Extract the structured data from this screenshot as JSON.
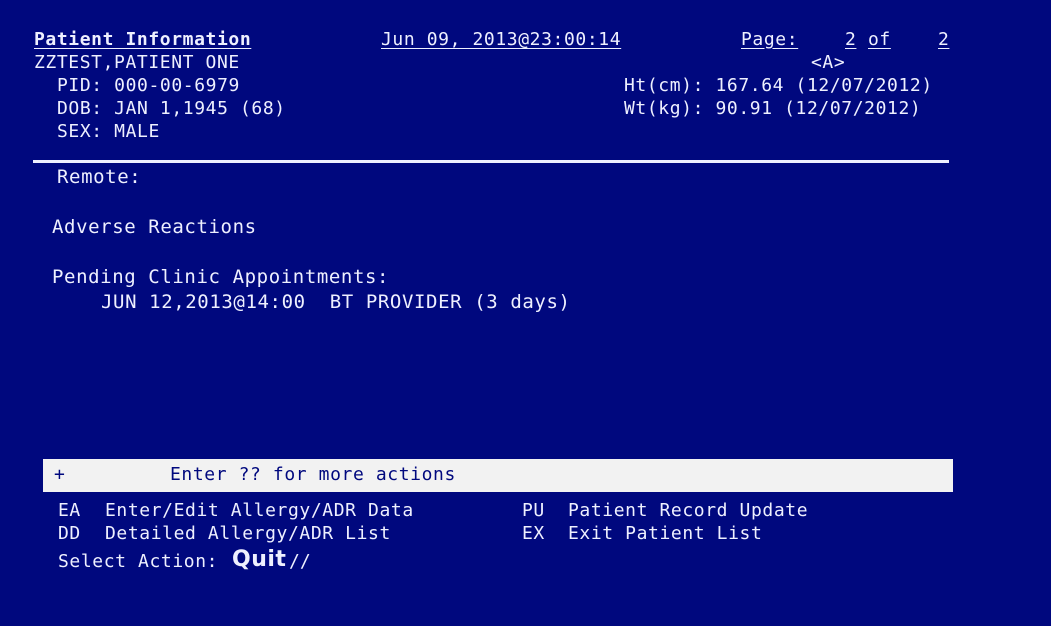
{
  "header": {
    "title": "Patient Information",
    "datetime": "Jun 09, 2013@23:00:14",
    "page_label": "Page:",
    "page_current": "2",
    "page_of": "of",
    "page_total": "2",
    "flag": "<A>"
  },
  "patient": {
    "name": "ZZTEST,PATIENT ONE",
    "pid_line": "PID: 000-00-6979",
    "dob_line": "DOB: JAN 1,1945 (68)",
    "sex_line": "SEX: MALE",
    "height_line": "Ht(cm): 167.64 (12/07/2012)",
    "weight_line": "Wt(kg): 90.91 (12/07/2012)"
  },
  "content": {
    "remote_label": "Remote:",
    "adverse_reactions_heading": "Adverse Reactions",
    "pending_appointments_heading": "Pending Clinic Appointments:",
    "appointments": [
      "JUN 12,2013@14:00  BT PROVIDER (3 days)"
    ]
  },
  "action_bar": {
    "plus": "+",
    "message": "Enter ?? for more actions"
  },
  "actions": [
    {
      "code": "EA",
      "label": "Enter/Edit Allergy/ADR Data"
    },
    {
      "code": "PU",
      "label": "Patient Record Update"
    },
    {
      "code": "DD",
      "label": "Detailed Allergy/ADR List"
    },
    {
      "code": "EX",
      "label": "Exit Patient List"
    }
  ],
  "prompt": {
    "label": "Select Action:",
    "default_value": "Quit",
    "suffix": "//"
  },
  "colors": {
    "background": "#00087e",
    "foreground": "#eef0ff",
    "action_bar_bg": "#f2f2f2"
  }
}
